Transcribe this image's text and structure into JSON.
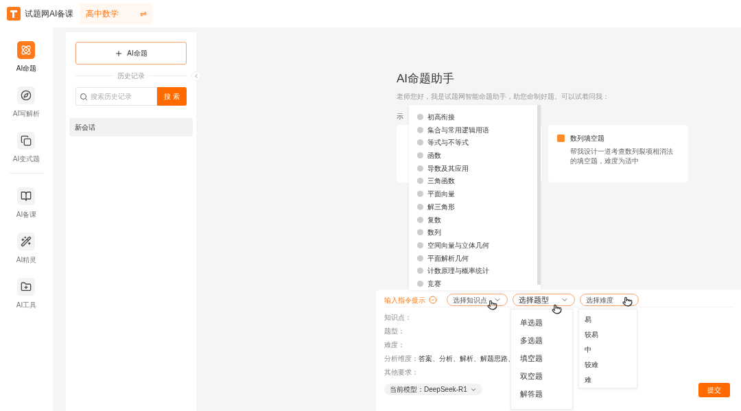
{
  "header": {
    "brand": "试题网AI备课",
    "subject": "高中数学",
    "switch_glyph": "⇌"
  },
  "nav": [
    {
      "label": "AI命题",
      "kind": "atom",
      "selected": true
    },
    {
      "label": "AI写解析",
      "kind": "compass",
      "selected": false
    },
    {
      "label": "AI变式题",
      "kind": "copy",
      "selected": false
    },
    {
      "label": "AI备课",
      "kind": "book",
      "selected": false
    },
    {
      "label": "AI精灵",
      "kind": "wand",
      "selected": false
    },
    {
      "label": "AI工具",
      "kind": "folder",
      "selected": false
    }
  ],
  "history": {
    "new_button": "AI命题",
    "divider": "历史记录",
    "search_placeholder": "搜索历史记录",
    "search_button": "搜 索",
    "sessions": [
      {
        "label": "新会话",
        "selected": true
      }
    ]
  },
  "main": {
    "title": "AI命题助手",
    "subtitle": "老师您好，我是试题网智能命题助手，助您命制好题。可以试着问我：",
    "example_label": "示",
    "cards": [
      {
        "title": "数列填空题",
        "description": "帮我设计一道考查数列裂项相消法的填空题，难度为适中"
      }
    ]
  },
  "knowledge_menu": [
    "初高衔接",
    "集合与常用逻辑用语",
    "等式与不等式",
    "函数",
    "导数及其应用",
    "三角函数",
    "平面向量",
    "解三角形",
    "复数",
    "数列",
    "空间向量与立体几何",
    "平面解析几何",
    "计数原理与概率统计",
    "竞赛"
  ],
  "composer": {
    "hint": "输入指令提示",
    "selectors": [
      {
        "label": "选择知识点",
        "selected": false
      },
      {
        "label": "选择题型",
        "selected": true
      },
      {
        "label": "选择难度",
        "selected": false
      }
    ],
    "fields": [
      {
        "label": "知识点："
      },
      {
        "label": "题型："
      },
      {
        "label": "难度："
      },
      {
        "label": "分析维度：",
        "value": "答案、分析、解析、解题思路、"
      },
      {
        "label": "其他要求："
      }
    ],
    "model": "当前模型：DeepSeek-R1",
    "submit": "提交"
  },
  "type_menu": [
    "单选题",
    "多选题",
    "填空题",
    "双空题",
    "解答题"
  ],
  "difficulty_menu": [
    "易",
    "较易",
    "中",
    "较难",
    "难"
  ]
}
